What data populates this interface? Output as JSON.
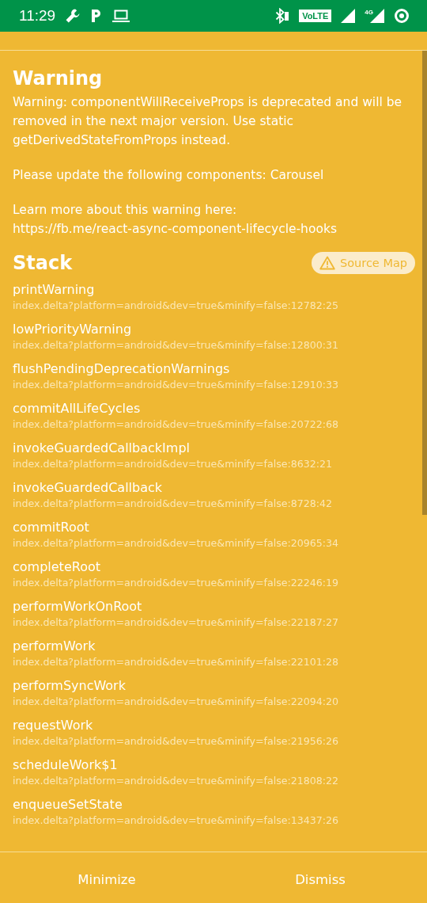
{
  "status_bar": {
    "time": "11:29",
    "volte": "VoLTE",
    "network": "4G"
  },
  "warning": {
    "title": "Warning",
    "paragraphs": [
      "Warning: componentWillReceiveProps is deprecated and will be removed in the next major version. Use static getDerivedStateFromProps instead.",
      "Please update the following components: Carousel",
      "Learn more about this warning here:\nhttps://fb.me/react-async-component-lifecycle-hooks"
    ]
  },
  "stack": {
    "title": "Stack",
    "source_map_button": "Source Map",
    "frames": [
      {
        "method": "printWarning",
        "location": "index.delta?platform=android&dev=true&minify=false:12782:25"
      },
      {
        "method": "lowPriorityWarning",
        "location": "index.delta?platform=android&dev=true&minify=false:12800:31"
      },
      {
        "method": "flushPendingDeprecationWarnings",
        "location": "index.delta?platform=android&dev=true&minify=false:12910:33"
      },
      {
        "method": "commitAllLifeCycles",
        "location": "index.delta?platform=android&dev=true&minify=false:20722:68"
      },
      {
        "method": "invokeGuardedCallbackImpl",
        "location": "index.delta?platform=android&dev=true&minify=false:8632:21"
      },
      {
        "method": "invokeGuardedCallback",
        "location": "index.delta?platform=android&dev=true&minify=false:8728:42"
      },
      {
        "method": "commitRoot",
        "location": "index.delta?platform=android&dev=true&minify=false:20965:34"
      },
      {
        "method": "completeRoot",
        "location": "index.delta?platform=android&dev=true&minify=false:22246:19"
      },
      {
        "method": "performWorkOnRoot",
        "location": "index.delta?platform=android&dev=true&minify=false:22187:27"
      },
      {
        "method": "performWork",
        "location": "index.delta?platform=android&dev=true&minify=false:22101:28"
      },
      {
        "method": "performSyncWork",
        "location": "index.delta?platform=android&dev=true&minify=false:22094:20"
      },
      {
        "method": "requestWork",
        "location": "index.delta?platform=android&dev=true&minify=false:21956:26"
      },
      {
        "method": "scheduleWork$1",
        "location": "index.delta?platform=android&dev=true&minify=false:21808:22"
      },
      {
        "method": "enqueueSetState",
        "location": "index.delta?platform=android&dev=true&minify=false:13437:26"
      }
    ]
  },
  "footer": {
    "buttons": [
      "Minimize",
      "Dismiss"
    ]
  }
}
